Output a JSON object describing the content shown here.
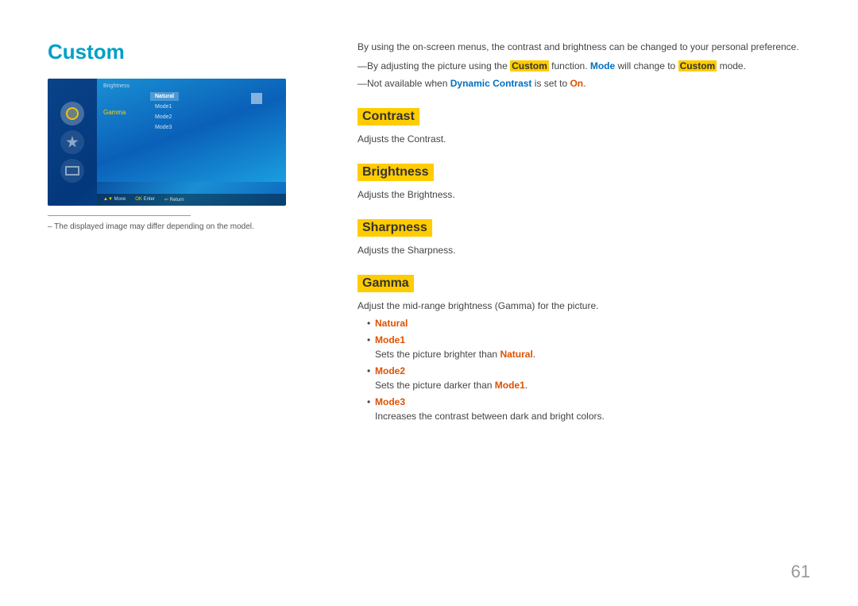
{
  "page": {
    "title": "Custom",
    "number": "61"
  },
  "footnote": {
    "divider": true,
    "text": "– The displayed image may differ depending on the model."
  },
  "intro": {
    "line1": "By using the on-screen menus, the contrast and brightness can be changed to your personal preference.",
    "bullet1_prefix": "By adjusting the picture using the ",
    "bullet1_custom": "Custom",
    "bullet1_mid": " function, ",
    "bullet1_mode": "Mode",
    "bullet1_suffix": " will change to ",
    "bullet1_custom2": "Custom",
    "bullet1_end": " mode.",
    "bullet2_prefix": "Not available when ",
    "bullet2_dc": "Dynamic Contrast",
    "bullet2_mid": " is set to ",
    "bullet2_on": "On",
    "bullet2_end": "."
  },
  "sections": {
    "contrast": {
      "heading": "Contrast",
      "desc": "Adjusts the Contrast."
    },
    "brightness": {
      "heading": "Brightness",
      "desc": "Adjusts the Brightness."
    },
    "sharpness": {
      "heading": "Sharpness",
      "desc": "Adjusts the Sharpness."
    },
    "gamma": {
      "heading": "Gamma",
      "desc": "Adjust the mid-range brightness (Gamma) for the picture.",
      "items": [
        {
          "label": "Natural",
          "sub": ""
        },
        {
          "label": "Mode1",
          "sub": "Sets the picture brighter than Natural."
        },
        {
          "label": "Mode2",
          "sub": "Sets the picture darker than Mode1."
        },
        {
          "label": "Mode3",
          "sub": "Increases the contrast between dark and bright colors."
        }
      ]
    }
  },
  "tv_menu": {
    "top_text": "Brightness",
    "menu_label": "Gamma",
    "submenu_items": [
      "Natural",
      "Mode1",
      "Mode2",
      "Mode3"
    ],
    "selected_index": 0,
    "bottom_buttons": [
      "▲▼ Move",
      "OK Enter",
      "↩ Return"
    ]
  }
}
